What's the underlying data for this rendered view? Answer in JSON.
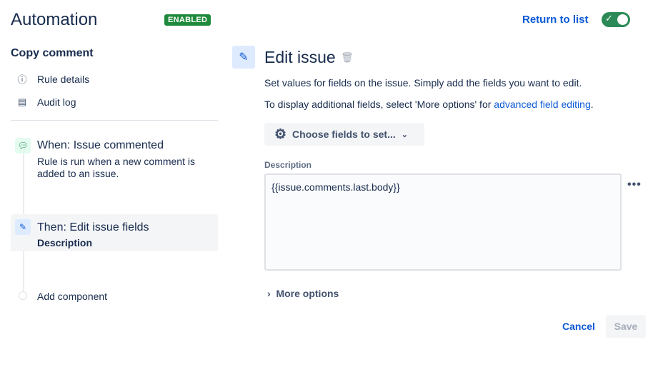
{
  "header": {
    "title": "Automation",
    "status": "ENABLED",
    "return_label": "Return to list",
    "enabled": true
  },
  "sidebar": {
    "rule_name": "Copy comment",
    "items": [
      {
        "label": "Rule details",
        "icon": "info-icon"
      },
      {
        "label": "Audit log",
        "icon": "document-icon"
      }
    ],
    "trigger": {
      "title": "When: Issue commented",
      "description": "Rule is run when a new comment is added to an issue."
    },
    "action": {
      "title": "Then: Edit issue fields",
      "subtitle": "Description"
    },
    "add_component": "Add component"
  },
  "main": {
    "title": "Edit issue",
    "desc1": "Set values for fields on the issue. Simply add the fields you want to edit.",
    "desc2_prefix": "To display additional fields, select 'More options' for ",
    "desc2_link": "advanced field editing",
    "desc2_suffix": ".",
    "choose_fields": "Choose fields to set...",
    "field_label": "Description",
    "field_value": "{{issue.comments.last.body}}",
    "more_options": "More options",
    "cancel": "Cancel",
    "save": "Save"
  },
  "colors": {
    "accent": "#0c59d6",
    "success": "#2b8a57"
  }
}
